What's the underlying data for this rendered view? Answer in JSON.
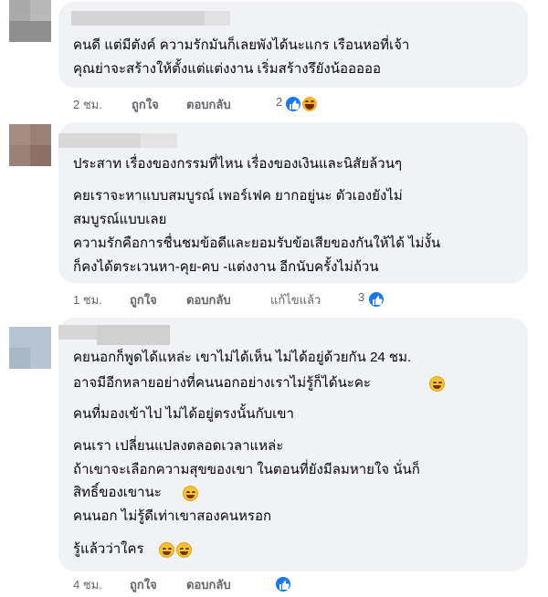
{
  "comments": [
    {
      "lines": [
        "คนดี แต่มีตังค์ ความรักมันก็เลยพังได้นะแกร เรือนหอที่เจ้า",
        "คุณย่าจะสร้างให้ตั้งแต่แต่งงาน เริ่มสร้างรึยังน้อออออ"
      ],
      "time": "2 ชม.",
      "like_label": "ถูกใจ",
      "reply_label": "ตอบกลับ",
      "edited_label": "",
      "reaction_count": "2",
      "reactions": [
        "like-icon",
        "haha-icon"
      ]
    },
    {
      "lines": [
        "ประสาท เรื่องของกรรมที่ไหน เรื่องของเงินและนิสัยล้วนๆ",
        "คยเราจะหาแบบสมบูรณ์ เพอร์เฟค ยากอยู่นะ ตัวเองยังไม่",
        "สมบูรณ์แบบเลย",
        "ความรักคือการชื่นชมข้อดีและยอมรับข้อเสียของกันให้ได้ ไม่งั้น",
        "ก็คงได้ตระเวนหา-คุย-คบ -แต่งงาน อีกนับครั้งไม่ถ้วน"
      ],
      "time": "1 ชม.",
      "like_label": "ถูกใจ",
      "reply_label": "ตอบกลับ",
      "edited_label": "แก้ไขแล้ว",
      "reaction_count": "3",
      "reactions": [
        "like-icon"
      ]
    },
    {
      "lines": [
        "คยนอกก็พูดได้แหล่ะ เขาไม่ได้เห็น ไม่ได้อยู่ด้วยกัน 24 ชม.",
        "อาจมีอีกหลายอย่างที่คนนอกอย่างเราไม่รู้ก็ได้นะคะ",
        "คนที่มองเข้าไป ไม่ได้อยู่ตรงนั้นกับเขา",
        "คนเรา เปลี่ยนแปลงตลอดเวลาแหล่ะ",
        "ถ้าเขาจะเลือกความสุขของเขา ในตอนที่ยังมีลมหายใจ นั่นก็",
        "สิทธิ์ของเขานะ",
        "คนนอก ไม่รู้ดีเท่าเขาสองคนหรอก",
        "รู้แล้วว่าใคร"
      ],
      "time": "4 ชม.",
      "like_label": "ถูกใจ",
      "reply_label": "ตอบกลับ",
      "edited_label": "",
      "reaction_count": "",
      "reactions": [
        "like-icon"
      ]
    }
  ],
  "colors": {
    "bubble": "#f0f2f5",
    "meta_text": "#65676b",
    "like_blue": "#1877f2",
    "haha_yellow": "#f7b125"
  }
}
